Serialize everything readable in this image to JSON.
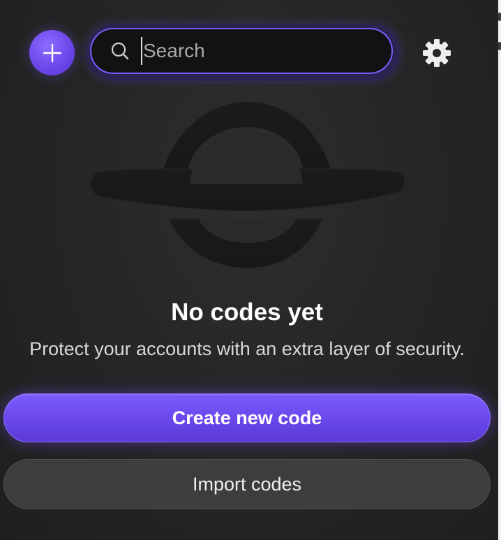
{
  "header": {
    "add_button_icon": "plus-icon",
    "search": {
      "placeholder": "Search",
      "value": "",
      "icon": "search-icon"
    },
    "settings_icon": "gear-icon"
  },
  "empty_state": {
    "illustration_icon": "planet-ring-illustration",
    "title": "No codes yet",
    "subtitle": "Protect your accounts with an extra layer of security."
  },
  "actions": {
    "create_label": "Create new code",
    "import_label": "Import codes"
  },
  "colors": {
    "accent": "#6a48ec",
    "accent_border": "#7a5cff",
    "background": "#262626",
    "secondary_button": "#3d3d3d"
  }
}
